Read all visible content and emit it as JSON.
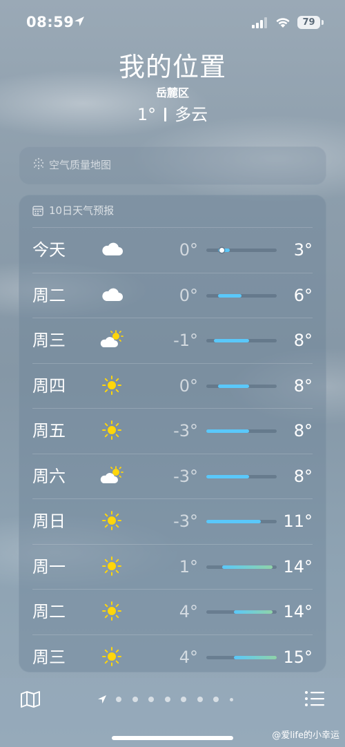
{
  "status_bar": {
    "time": "08:59",
    "battery": "79"
  },
  "header": {
    "title": "我的位置",
    "district": "岳麓区",
    "temperature": "1°",
    "condition": "多云"
  },
  "air_card": {
    "label": "空气质量地图",
    "icon": "air-quality-map-icon"
  },
  "forecast": {
    "title": "10日天气预报",
    "icon": "calendar-icon",
    "range_min": -3,
    "range_max": 15,
    "days": [
      {
        "day": "今天",
        "icon": "cloudy",
        "low": "0°",
        "high": "3°",
        "lo_val": 0,
        "hi_val": 3,
        "current": 1
      },
      {
        "day": "周二",
        "icon": "cloudy",
        "low": "0°",
        "high": "6°",
        "lo_val": 0,
        "hi_val": 6
      },
      {
        "day": "周三",
        "icon": "partly-cloudy",
        "low": "-1°",
        "high": "8°",
        "lo_val": -1,
        "hi_val": 8
      },
      {
        "day": "周四",
        "icon": "sunny",
        "low": "0°",
        "high": "8°",
        "lo_val": 0,
        "hi_val": 8
      },
      {
        "day": "周五",
        "icon": "sunny",
        "low": "-3°",
        "high": "8°",
        "lo_val": -3,
        "hi_val": 8
      },
      {
        "day": "周六",
        "icon": "partly-cloudy",
        "low": "-3°",
        "high": "8°",
        "lo_val": -3,
        "hi_val": 8
      },
      {
        "day": "周日",
        "icon": "sunny",
        "low": "-3°",
        "high": "11°",
        "lo_val": -3,
        "hi_val": 11
      },
      {
        "day": "周一",
        "icon": "sunny",
        "low": "1°",
        "high": "14°",
        "lo_val": 1,
        "hi_val": 14
      },
      {
        "day": "周二",
        "icon": "sunny",
        "low": "4°",
        "high": "14°",
        "lo_val": 4,
        "hi_val": 14
      },
      {
        "day": "周三",
        "icon": "sunny",
        "low": "4°",
        "high": "15°",
        "lo_val": 4,
        "hi_val": 15
      }
    ]
  },
  "bottom_bar": {
    "map_icon": "map-icon",
    "list_icon": "list-icon",
    "page_count": 9,
    "current_page": 0
  },
  "watermark": "@爱life的小幸运",
  "colors": {
    "bar_cool": "#5ac8fa",
    "bar_warm": "#8fd3a8"
  }
}
